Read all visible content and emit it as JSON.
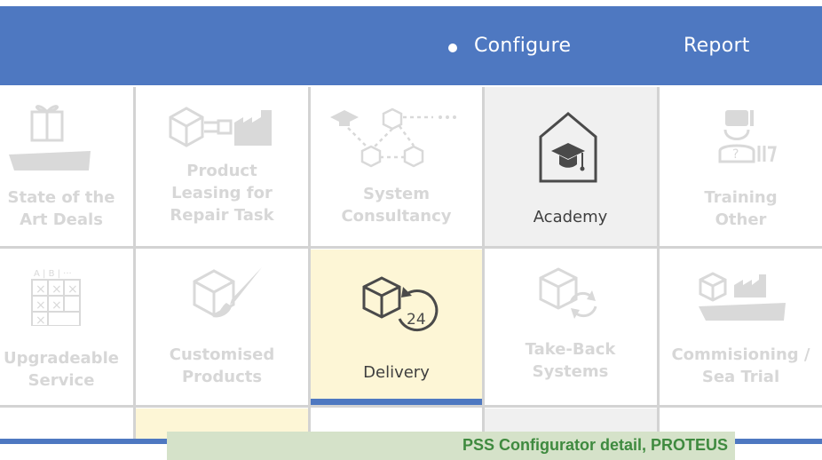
{
  "nav": {
    "configure_label": "Configure",
    "report_label": "Report"
  },
  "cells": {
    "state_of_art": "State of the\nArt Deals",
    "product_leasing": "Product\nLeasing for\nRepair Task",
    "system_consultancy": "System\nConsultancy",
    "academy": "Academy",
    "training_other": "Training\nOther",
    "upgradeable_service": "Upgradeable\nService",
    "customised_products": "Customised\nProducts",
    "delivery": "Delivery",
    "take_back": "Take-Back\nSystems",
    "commissioning": "Commisioning /\nSea Trial"
  },
  "icons": {
    "delivery_badge": "24",
    "matrix_cols": "A | B | ···"
  },
  "caption": "PSS Configurator detail, PROTEUS",
  "colors": {
    "header_blue": "#4e78c1",
    "selected_yellow": "#fdf6d6",
    "academy_gray": "#f0f0f0",
    "caption_green": "#3f8a3f",
    "caption_bg": "#d5e2c9"
  }
}
